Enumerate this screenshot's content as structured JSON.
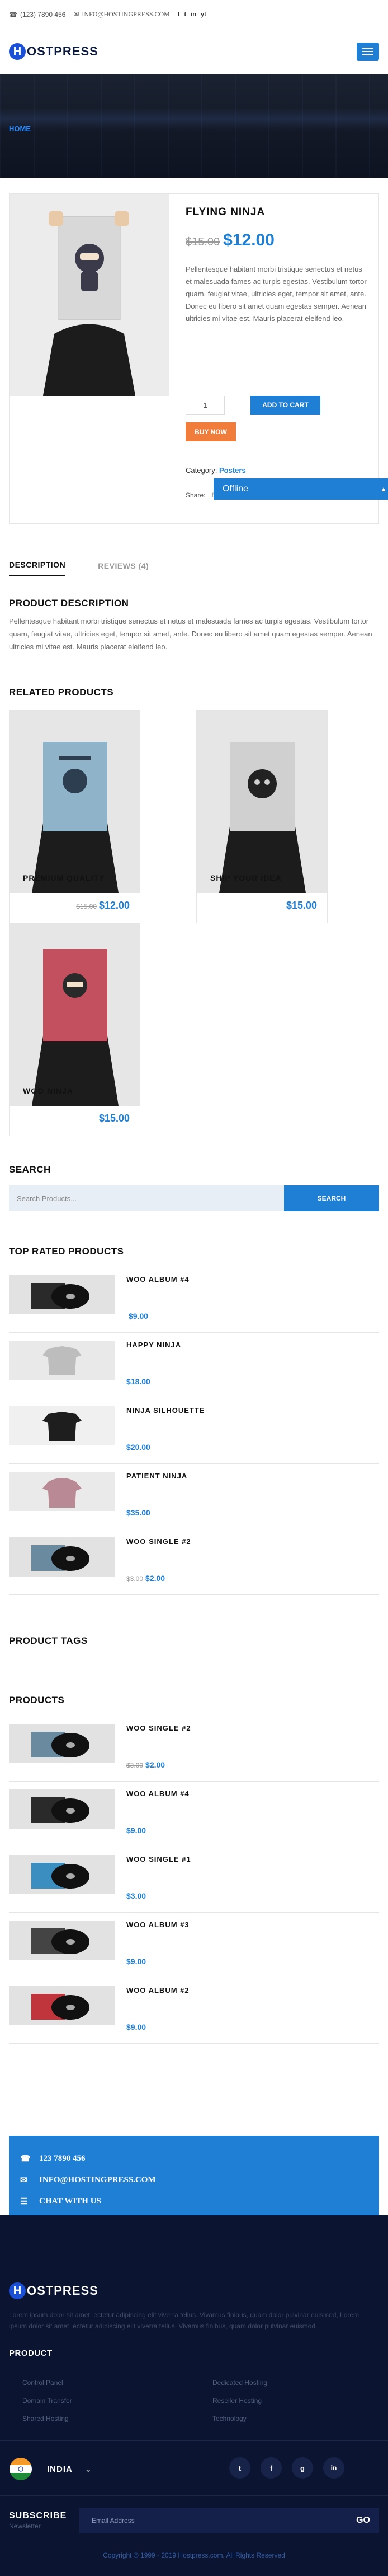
{
  "topbar": {
    "phone": "(123) 7890 456",
    "email": "INFO@HOSTINGPRESS.COM",
    "social": [
      "f",
      "t",
      "in",
      "yt"
    ]
  },
  "brand": {
    "letter": "H",
    "name": "OSTPRESS"
  },
  "hero": {
    "breadcrumb": "HOME"
  },
  "product": {
    "title": "FLYING NINJA",
    "old_price": "$15.00",
    "price": "$12.00",
    "description": "Pellentesque habitant morbi tristique senectus et netus et malesuada fames ac turpis egestas. Vestibulum tortor quam, feugiat vitae, ultricies eget, tempor sit amet, ante. Donec eu libero sit amet quam egestas semper. Aenean ultricies mi vitae est. Mauris placerat eleifend leo.",
    "qty": "1",
    "add_to_cart": "ADD TO CART",
    "buy_now": "BUY NOW",
    "category_label": "Category:",
    "category": "Posters",
    "share_label": "Share:"
  },
  "chat": {
    "status": "Offline"
  },
  "tabs": [
    {
      "label": "DESCRIPTION"
    },
    {
      "label": "REVIEWS (4)"
    }
  ],
  "description": {
    "heading": "PRODUCT DESCRIPTION",
    "text": "Pellentesque habitant morbi tristique senectus et netus et malesuada fames ac turpis egestas. Vestibulum tortor quam, feugiat vitae, ultricies eget, tempor sit amet, ante. Donec eu libero sit amet quam egestas semper. Aenean ultricies mi vitae est. Mauris placerat eleifend leo."
  },
  "related": {
    "heading": "RELATED PRODUCTS",
    "items": [
      {
        "title": "PREMIUM QUALITY",
        "old": "$15.00",
        "price": "$12.00"
      },
      {
        "title": "SHIP YOUR IDEA",
        "old": "",
        "price": "$15.00"
      },
      {
        "title": "WOO NINJA",
        "old": "",
        "price": "$15.00"
      }
    ]
  },
  "search": {
    "heading": "SEARCH",
    "placeholder": "Search Products...",
    "button": "SEARCH"
  },
  "top_rated": {
    "heading": "TOP RATED PRODUCTS",
    "items": [
      {
        "title": "WOO ALBUM #4",
        "old": "",
        "price": "$9.00"
      },
      {
        "title": "HAPPY NINJA",
        "old": "",
        "price": "$18.00"
      },
      {
        "title": "NINJA SILHOUETTE",
        "old": "",
        "price": "$20.00"
      },
      {
        "title": "PATIENT NINJA",
        "old": "",
        "price": "$35.00"
      },
      {
        "title": "WOO SINGLE #2",
        "old": "$3.00",
        "price": "$2.00"
      }
    ]
  },
  "tags": {
    "heading": "PRODUCT TAGS"
  },
  "products": {
    "heading": "PRODUCTS",
    "items": [
      {
        "title": "WOO SINGLE #2",
        "old": "$3.00",
        "price": "$2.00"
      },
      {
        "title": "WOO ALBUM #4",
        "old": "",
        "price": "$9.00"
      },
      {
        "title": "WOO SINGLE #1",
        "old": "",
        "price": "$3.00"
      },
      {
        "title": "WOO ALBUM #3",
        "old": "",
        "price": "$9.00"
      },
      {
        "title": "WOO ALBUM #2",
        "old": "",
        "price": "$9.00"
      }
    ]
  },
  "contact": {
    "phone": "123 7890 456",
    "email": "INFO@HOSTINGPRESS.COM",
    "chat": "CHAT WITH US"
  },
  "footer": {
    "about": "Lorem ipsum dolor sit amet, ectetur adipiscing elit viverra tellus. Vivamus finibus, quam dolor pulvinar euismod, Lorem ipsum dolor sit amet, ectetur adipiscing elit viverra tellus. Vivamus finibus, quam dolor pulvinar euismod.",
    "product_heading": "PRODUCT",
    "links": [
      "Control Panel",
      "Dedicated Hosting",
      "Domain Transfer",
      "Reseller Hosting",
      "Shared Hosting",
      "Technology"
    ],
    "country": "INDIA",
    "subscribe_title": "SUBSCRIBE",
    "subscribe_sub": "Newsletter",
    "email_placeholder": "Email Address",
    "go": "GO",
    "copyright": "Copyright © 1999 - 2019 Hostpress.com. All Rights Reserved"
  },
  "colors": {
    "accent": "#1e7fd4",
    "orange": "#f07d3c",
    "footer_bg": "#0b1430"
  }
}
